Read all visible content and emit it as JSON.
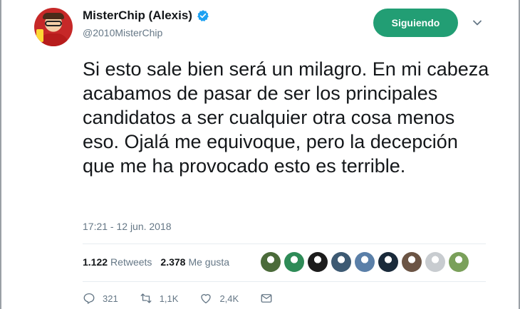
{
  "author": {
    "display_name": "MisterChip (Alexis)",
    "handle": "@2010MisterChip",
    "verified": true,
    "avatar_icon": "cartoon-avatar"
  },
  "follow_button": {
    "label": "Siguiendo",
    "color": "#229e74"
  },
  "tweet": {
    "text": "Si esto sale bien será un milagro. En mi cabeza acabamos de pasar de ser los principales candidatos a ser cualquier otra cosa menos eso. Ojalá me equivoque, pero la decepción que me ha provocado esto es terrible.",
    "timestamp": "17:21 - 12 jun. 2018"
  },
  "stats": {
    "retweets_count": "1.122",
    "retweets_label": "Retweets",
    "likes_count": "2.378",
    "likes_label": "Me gusta"
  },
  "liker_avatars": [
    {
      "name": "liker-avatar-1",
      "color": "#4b6b3a"
    },
    {
      "name": "liker-avatar-2",
      "color": "#2e8b57"
    },
    {
      "name": "liker-avatar-3",
      "color": "#1c1c1c"
    },
    {
      "name": "liker-avatar-4",
      "color": "#3d5a73"
    },
    {
      "name": "liker-avatar-5",
      "color": "#5a7fa8"
    },
    {
      "name": "liker-avatar-6",
      "color": "#1a2a3a"
    },
    {
      "name": "liker-avatar-7",
      "color": "#6b5444"
    },
    {
      "name": "liker-avatar-8",
      "color": "#c8ccd0"
    },
    {
      "name": "liker-avatar-9",
      "color": "#7aa05a"
    }
  ],
  "actions": {
    "replies": "321",
    "retweets": "1,1K",
    "likes": "2,4K"
  },
  "colors": {
    "text_primary": "#14171a",
    "text_secondary": "#657786",
    "verified_blue": "#1da1f2"
  }
}
